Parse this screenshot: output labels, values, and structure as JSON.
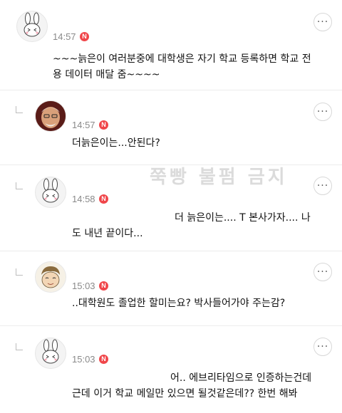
{
  "watermark": "쭉빵 불펌 금지",
  "comments": [
    {
      "time": "14:57",
      "badge": "N",
      "more": "···",
      "avatar": "rabbit-avatar",
      "lines": [
        "~~~늙은이 여러분중에 대학생은 자기 학교 등록하면 학교 전",
        "용 데이터 매달 줌~~~~"
      ]
    },
    {
      "time": "14:57",
      "badge": "N",
      "more": "···",
      "avatar": "old-man-photo-avatar",
      "lines": [
        "더늙은이는...안된다?"
      ]
    },
    {
      "time": "14:58",
      "badge": "N",
      "more": "···",
      "avatar": "rabbit-avatar",
      "lines": [
        "더 늙은이는.... T 본사가자.... 나",
        "도 내년 끝이다..."
      ]
    },
    {
      "time": "15:03",
      "badge": "N",
      "more": "···",
      "avatar": "cartoon-character-avatar",
      "lines": [
        "..대학원도 졸업한 할미는요? 박사들어가야 주는감?"
      ]
    },
    {
      "time": "15:03",
      "badge": "N",
      "more": "···",
      "avatar": "rabbit-avatar",
      "lines": [
        "어.. 에브리타임으로 인증하는건데",
        "근데 이거 학교 메일만 있으면 될것같은데?? 한번 해봐"
      ]
    }
  ]
}
